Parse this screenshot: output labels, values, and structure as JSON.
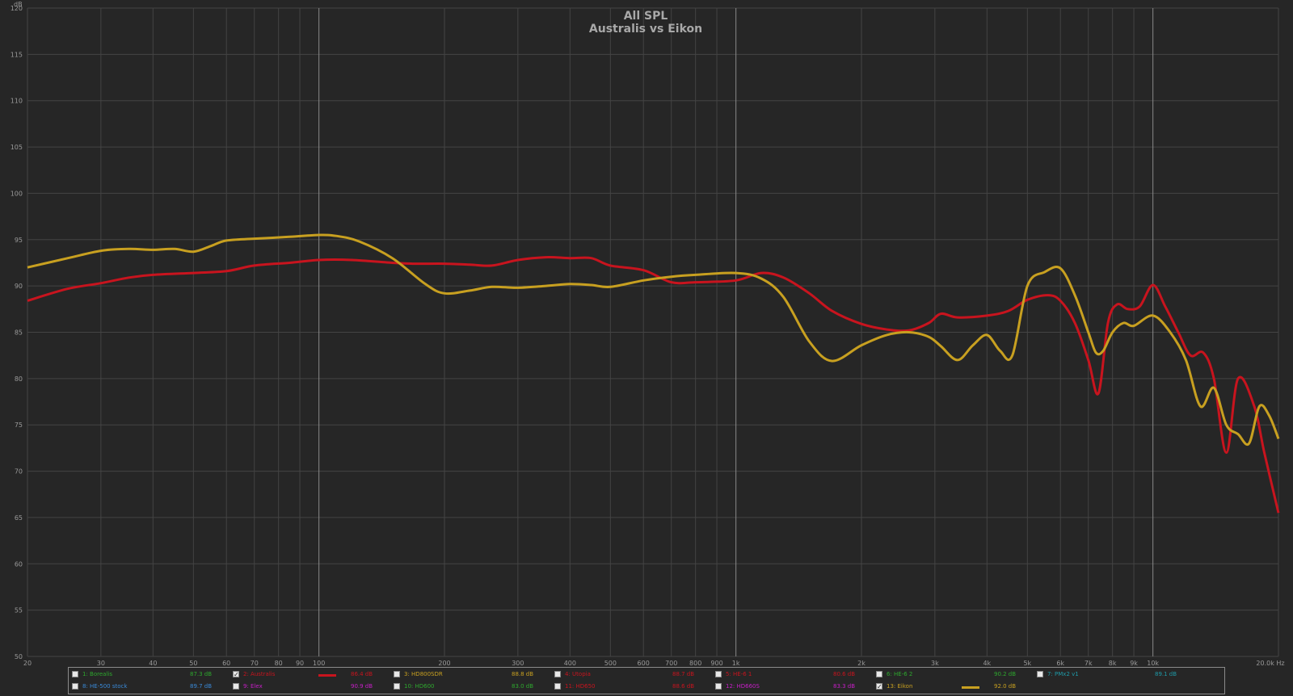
{
  "chart_data": {
    "type": "line",
    "title": "All SPL",
    "subtitle": "Australis vs Eikon",
    "ylabel": "dB",
    "xunit": "Hz",
    "xscale": "log",
    "xlim": [
      20,
      20000
    ],
    "ylim": [
      50,
      120
    ],
    "grid": true,
    "legend_placement": "bottom",
    "xticks": [
      {
        "v": 20,
        "label": "20"
      },
      {
        "v": 30,
        "label": "30"
      },
      {
        "v": 40,
        "label": "40"
      },
      {
        "v": 50,
        "label": "50"
      },
      {
        "v": 60,
        "label": "60"
      },
      {
        "v": 70,
        "label": "70"
      },
      {
        "v": 80,
        "label": "80"
      },
      {
        "v": 90,
        "label": "90"
      },
      {
        "v": 100,
        "label": "100"
      },
      {
        "v": 200,
        "label": "200"
      },
      {
        "v": 300,
        "label": "300"
      },
      {
        "v": 400,
        "label": "400"
      },
      {
        "v": 500,
        "label": "500"
      },
      {
        "v": 600,
        "label": "600"
      },
      {
        "v": 700,
        "label": "700"
      },
      {
        "v": 800,
        "label": "800"
      },
      {
        "v": 900,
        "label": "900"
      },
      {
        "v": 1000,
        "label": "1k"
      },
      {
        "v": 2000,
        "label": "2k"
      },
      {
        "v": 3000,
        "label": "3k"
      },
      {
        "v": 4000,
        "label": "4k"
      },
      {
        "v": 5000,
        "label": "5k"
      },
      {
        "v": 6000,
        "label": "6k"
      },
      {
        "v": 7000,
        "label": "7k"
      },
      {
        "v": 8000,
        "label": "8k"
      },
      {
        "v": 9000,
        "label": "9k"
      },
      {
        "v": 10000,
        "label": "10k"
      },
      {
        "v": 20000,
        "label": "20.0k Hz"
      }
    ],
    "yticks": [
      {
        "v": 50,
        "label": "50"
      },
      {
        "v": 55,
        "label": "55"
      },
      {
        "v": 60,
        "label": "60"
      },
      {
        "v": 65,
        "label": "65"
      },
      {
        "v": 70,
        "label": "70"
      },
      {
        "v": 75,
        "label": "75"
      },
      {
        "v": 80,
        "label": "80"
      },
      {
        "v": 85,
        "label": "85"
      },
      {
        "v": 90,
        "label": "90"
      },
      {
        "v": 95,
        "label": "95"
      },
      {
        "v": 100,
        "label": "100"
      },
      {
        "v": 105,
        "label": "105"
      },
      {
        "v": 110,
        "label": "110"
      },
      {
        "v": 115,
        "label": "115"
      },
      {
        "v": 120,
        "label": "120"
      }
    ],
    "series": [
      {
        "name": "2: Australis",
        "color": "#c8141e",
        "x": [
          20,
          25,
          30,
          35,
          40,
          50,
          60,
          70,
          85,
          100,
          120,
          150,
          170,
          200,
          230,
          260,
          300,
          350,
          400,
          450,
          500,
          600,
          700,
          800,
          1000,
          1150,
          1300,
          1500,
          1700,
          2000,
          2300,
          2600,
          2900,
          3100,
          3400,
          4000,
          4500,
          5000,
          5600,
          6000,
          6500,
          7000,
          7400,
          7800,
          8200,
          8700,
          9300,
          10000,
          10700,
          11500,
          12300,
          13200,
          14000,
          15000,
          16000,
          17500,
          18500,
          20000
        ],
        "y": [
          88.4,
          89.7,
          90.3,
          90.9,
          91.2,
          91.4,
          91.6,
          92.2,
          92.5,
          92.8,
          92.8,
          92.5,
          92.4,
          92.4,
          92.3,
          92.2,
          92.8,
          93.1,
          93.0,
          93.0,
          92.2,
          91.7,
          90.4,
          90.4,
          90.6,
          91.4,
          90.9,
          89.2,
          87.3,
          85.9,
          85.3,
          85.2,
          86.0,
          87.0,
          86.6,
          86.8,
          87.3,
          88.5,
          89.0,
          88.4,
          86.0,
          82.0,
          78.4,
          86.0,
          88.0,
          87.5,
          87.8,
          90.1,
          87.8,
          85.0,
          82.5,
          82.8,
          80.0,
          72.0,
          80.0,
          77.0,
          72.0,
          65.5
        ]
      },
      {
        "name": "13: Eikon",
        "color": "#c8a020",
        "x": [
          20,
          25,
          30,
          35,
          40,
          45,
          50,
          55,
          60,
          70,
          85,
          100,
          110,
          125,
          150,
          180,
          200,
          230,
          260,
          300,
          350,
          400,
          450,
          500,
          600,
          700,
          800,
          1000,
          1150,
          1300,
          1500,
          1700,
          2000,
          2300,
          2600,
          2900,
          3100,
          3400,
          3700,
          4000,
          4300,
          4600,
          5000,
          5500,
          6000,
          6500,
          7000,
          7300,
          7600,
          8000,
          8500,
          9000,
          10000,
          11000,
          12000,
          13000,
          14000,
          15000,
          16000,
          17000,
          18000,
          19000,
          20000
        ],
        "y": [
          92.0,
          93.0,
          93.8,
          94.0,
          93.9,
          94.0,
          93.7,
          94.3,
          94.9,
          95.1,
          95.3,
          95.5,
          95.4,
          94.8,
          93.0,
          90.2,
          89.2,
          89.5,
          89.9,
          89.8,
          90.0,
          90.2,
          90.1,
          89.9,
          90.6,
          91.0,
          91.2,
          91.4,
          90.8,
          88.8,
          84.0,
          81.9,
          83.6,
          84.7,
          85.0,
          84.5,
          83.5,
          82.0,
          83.6,
          84.7,
          83.0,
          82.5,
          90.0,
          91.5,
          91.9,
          89.0,
          85.0,
          82.8,
          83.0,
          85.0,
          86.0,
          85.7,
          86.8,
          85.0,
          82.0,
          77.0,
          79.0,
          75.0,
          74.0,
          73.0,
          77.0,
          76.0,
          73.5
        ]
      }
    ]
  },
  "legend": [
    {
      "name": "1: Borealis",
      "value": "87.3 dB",
      "checked": false,
      "color": "#2ea82e"
    },
    {
      "name": "2: Australis",
      "value": "86.4 dB",
      "checked": true,
      "color": "#c8141e"
    },
    {
      "name": "3: HD800SDR",
      "value": "88.8 dB",
      "checked": false,
      "color": "#c8a020"
    },
    {
      "name": "4: Utopia",
      "value": "88.7 dB",
      "checked": false,
      "color": "#c8141e"
    },
    {
      "name": "5: HE-6 1",
      "value": "80.6 dB",
      "checked": false,
      "color": "#c8141e"
    },
    {
      "name": "6: HE-6 2",
      "value": "90.2 dB",
      "checked": false,
      "color": "#2ea82e"
    },
    {
      "name": "7: PMx2 v1",
      "value": "89.1 dB",
      "checked": false,
      "color": "#1e9aa8"
    },
    {
      "name": "8: HE-500 stock",
      "value": "89.7 dB",
      "checked": false,
      "color": "#3a8ad8"
    },
    {
      "name": "9: Elex",
      "value": "90.9 dB",
      "checked": false,
      "color": "#c81ec8"
    },
    {
      "name": "10: HD600",
      "value": "83.0 dB",
      "checked": false,
      "color": "#2ea82e"
    },
    {
      "name": "11: HD650",
      "value": "88.6 dB",
      "checked": false,
      "color": "#c8141e"
    },
    {
      "name": "12: HD660S",
      "value": "83.3 dB",
      "checked": false,
      "color": "#c81ec8"
    },
    {
      "name": "13: Eikon",
      "value": "92.0 dB",
      "checked": true,
      "color": "#c8a020"
    }
  ]
}
